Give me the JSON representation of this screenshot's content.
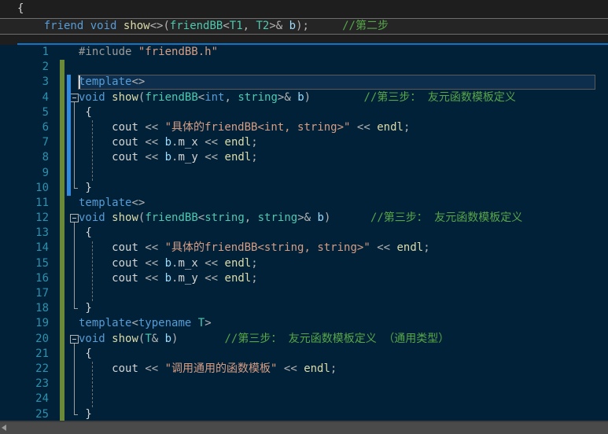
{
  "app": {
    "name": "visual-studio-code-editor",
    "theme": "dark-blue",
    "colors": {
      "editor_background": "#002137",
      "chrome_background": "#1e1e1e",
      "top_border_accent": "#0e76c8",
      "line_number": "#2b91af",
      "keyword": "#569cd6",
      "type": "#4ec9b0",
      "function": "#dcdcaa",
      "variable": "#9cdcfe",
      "string": "#d69d85",
      "comment": "#57a64a",
      "changed_gutter_green": "#6a8a3a",
      "unsaved_gutter_blue": "#2f8ae0",
      "scrollbar": "#4a4a4a"
    }
  },
  "top_pane": {
    "name": "context-fragment-pane",
    "lines": [
      {
        "n": "",
        "tokens": [
          {
            "t": "{",
            "c": "plain"
          }
        ]
      },
      {
        "n": "",
        "tokens": [
          {
            "t": "    ",
            "c": "plain"
          },
          {
            "t": "friend",
            "c": "kw"
          },
          {
            "t": " ",
            "c": "plain"
          },
          {
            "t": "void",
            "c": "kw"
          },
          {
            "t": " ",
            "c": "plain"
          },
          {
            "t": "show",
            "c": "fn"
          },
          {
            "t": "<>(",
            "c": "op"
          },
          {
            "t": "friendBB",
            "c": "typ"
          },
          {
            "t": "<",
            "c": "op"
          },
          {
            "t": "T1",
            "c": "typ"
          },
          {
            "t": ", ",
            "c": "op"
          },
          {
            "t": "T2",
            "c": "typ"
          },
          {
            "t": ">& ",
            "c": "op"
          },
          {
            "t": "b",
            "c": "var"
          },
          {
            "t": ");",
            "c": "op"
          },
          {
            "t": "     ",
            "c": "plain"
          },
          {
            "t": "//第二步",
            "c": "cmt"
          }
        ]
      }
    ]
  },
  "editor": {
    "name": "code-editor",
    "language": "cpp",
    "current_line": 3,
    "first_visible_line": 1,
    "last_visible_line": 25,
    "lines": [
      {
        "n": "1",
        "gutter": {
          "changed": false,
          "unsaved": false
        },
        "fold": null,
        "tokens": [
          {
            "t": "#include",
            "c": "pp"
          },
          {
            "t": " ",
            "c": "plain"
          },
          {
            "t": "\"friendBB.h\"",
            "c": "str"
          }
        ]
      },
      {
        "n": "2",
        "gutter": {
          "changed": true,
          "unsaved": false
        },
        "fold": null,
        "tokens": []
      },
      {
        "n": "3",
        "gutter": {
          "changed": true,
          "unsaved": true
        },
        "fold": null,
        "tokens": [
          {
            "t": "template",
            "c": "kw"
          },
          {
            "t": "<>",
            "c": "op"
          }
        ]
      },
      {
        "n": "4",
        "gutter": {
          "changed": true,
          "unsaved": true
        },
        "fold": "collapse",
        "tokens": [
          {
            "t": "void",
            "c": "kw"
          },
          {
            "t": " ",
            "c": "plain"
          },
          {
            "t": "show",
            "c": "fn"
          },
          {
            "t": "(",
            "c": "op"
          },
          {
            "t": "friendBB",
            "c": "typ"
          },
          {
            "t": "<",
            "c": "op"
          },
          {
            "t": "int",
            "c": "kw"
          },
          {
            "t": ", ",
            "c": "op"
          },
          {
            "t": "string",
            "c": "typ"
          },
          {
            "t": ">& ",
            "c": "op"
          },
          {
            "t": "b",
            "c": "var"
          },
          {
            "t": ")",
            "c": "op"
          },
          {
            "t": "        ",
            "c": "plain"
          },
          {
            "t": "//第三步： 友元函数模板定义",
            "c": "cmt"
          }
        ]
      },
      {
        "n": "5",
        "gutter": {
          "changed": true,
          "unsaved": true
        },
        "fold": null,
        "tokens": [
          {
            "t": " {",
            "c": "plain"
          }
        ]
      },
      {
        "n": "6",
        "gutter": {
          "changed": true,
          "unsaved": true
        },
        "fold": null,
        "tokens": [
          {
            "t": "     ",
            "c": "plain"
          },
          {
            "t": "cout",
            "c": "plain"
          },
          {
            "t": " ",
            "c": "plain"
          },
          {
            "t": "<<",
            "c": "op"
          },
          {
            "t": " ",
            "c": "plain"
          },
          {
            "t": "\"具体的friendBB<int, string>\"",
            "c": "str"
          },
          {
            "t": " ",
            "c": "plain"
          },
          {
            "t": "<<",
            "c": "op"
          },
          {
            "t": " ",
            "c": "plain"
          },
          {
            "t": "endl",
            "c": "mem"
          },
          {
            "t": ";",
            "c": "op"
          }
        ]
      },
      {
        "n": "7",
        "gutter": {
          "changed": true,
          "unsaved": true
        },
        "fold": null,
        "tokens": [
          {
            "t": "     ",
            "c": "plain"
          },
          {
            "t": "cout",
            "c": "plain"
          },
          {
            "t": " ",
            "c": "plain"
          },
          {
            "t": "<<",
            "c": "op"
          },
          {
            "t": " ",
            "c": "plain"
          },
          {
            "t": "b",
            "c": "var"
          },
          {
            "t": ".",
            "c": "op"
          },
          {
            "t": "m_x",
            "c": "plain"
          },
          {
            "t": " ",
            "c": "plain"
          },
          {
            "t": "<<",
            "c": "op"
          },
          {
            "t": " ",
            "c": "plain"
          },
          {
            "t": "endl",
            "c": "mem"
          },
          {
            "t": ";",
            "c": "op"
          }
        ]
      },
      {
        "n": "8",
        "gutter": {
          "changed": true,
          "unsaved": true
        },
        "fold": null,
        "tokens": [
          {
            "t": "     ",
            "c": "plain"
          },
          {
            "t": "cout",
            "c": "plain"
          },
          {
            "t": " ",
            "c": "plain"
          },
          {
            "t": "<<",
            "c": "op"
          },
          {
            "t": " ",
            "c": "plain"
          },
          {
            "t": "b",
            "c": "var"
          },
          {
            "t": ".",
            "c": "op"
          },
          {
            "t": "m_y",
            "c": "plain"
          },
          {
            "t": " ",
            "c": "plain"
          },
          {
            "t": "<<",
            "c": "op"
          },
          {
            "t": " ",
            "c": "plain"
          },
          {
            "t": "endl",
            "c": "mem"
          },
          {
            "t": ";",
            "c": "op"
          }
        ]
      },
      {
        "n": "9",
        "gutter": {
          "changed": true,
          "unsaved": true
        },
        "fold": null,
        "tokens": []
      },
      {
        "n": "10",
        "gutter": {
          "changed": true,
          "unsaved": true
        },
        "fold": "end",
        "tokens": [
          {
            "t": " }",
            "c": "plain"
          }
        ]
      },
      {
        "n": "11",
        "gutter": {
          "changed": true,
          "unsaved": false
        },
        "fold": null,
        "tokens": [
          {
            "t": "template",
            "c": "kw"
          },
          {
            "t": "<>",
            "c": "op"
          }
        ]
      },
      {
        "n": "12",
        "gutter": {
          "changed": true,
          "unsaved": false
        },
        "fold": "collapse",
        "tokens": [
          {
            "t": "void",
            "c": "kw"
          },
          {
            "t": " ",
            "c": "plain"
          },
          {
            "t": "show",
            "c": "fn"
          },
          {
            "t": "(",
            "c": "op"
          },
          {
            "t": "friendBB",
            "c": "typ"
          },
          {
            "t": "<",
            "c": "op"
          },
          {
            "t": "string",
            "c": "typ"
          },
          {
            "t": ", ",
            "c": "op"
          },
          {
            "t": "string",
            "c": "typ"
          },
          {
            "t": ">& ",
            "c": "op"
          },
          {
            "t": "b",
            "c": "var"
          },
          {
            "t": ")",
            "c": "op"
          },
          {
            "t": "      ",
            "c": "plain"
          },
          {
            "t": "//第三步： 友元函数模板定义",
            "c": "cmt"
          }
        ]
      },
      {
        "n": "13",
        "gutter": {
          "changed": true,
          "unsaved": false
        },
        "fold": null,
        "tokens": [
          {
            "t": " {",
            "c": "plain"
          }
        ]
      },
      {
        "n": "14",
        "gutter": {
          "changed": true,
          "unsaved": false
        },
        "fold": null,
        "tokens": [
          {
            "t": "     ",
            "c": "plain"
          },
          {
            "t": "cout",
            "c": "plain"
          },
          {
            "t": " ",
            "c": "plain"
          },
          {
            "t": "<<",
            "c": "op"
          },
          {
            "t": " ",
            "c": "plain"
          },
          {
            "t": "\"具体的friendBB<string, string>\"",
            "c": "str"
          },
          {
            "t": " ",
            "c": "plain"
          },
          {
            "t": "<<",
            "c": "op"
          },
          {
            "t": " ",
            "c": "plain"
          },
          {
            "t": "endl",
            "c": "mem"
          },
          {
            "t": ";",
            "c": "op"
          }
        ]
      },
      {
        "n": "15",
        "gutter": {
          "changed": true,
          "unsaved": false
        },
        "fold": null,
        "tokens": [
          {
            "t": "     ",
            "c": "plain"
          },
          {
            "t": "cout",
            "c": "plain"
          },
          {
            "t": " ",
            "c": "plain"
          },
          {
            "t": "<<",
            "c": "op"
          },
          {
            "t": " ",
            "c": "plain"
          },
          {
            "t": "b",
            "c": "var"
          },
          {
            "t": ".",
            "c": "op"
          },
          {
            "t": "m_x",
            "c": "plain"
          },
          {
            "t": " ",
            "c": "plain"
          },
          {
            "t": "<<",
            "c": "op"
          },
          {
            "t": " ",
            "c": "plain"
          },
          {
            "t": "endl",
            "c": "mem"
          },
          {
            "t": ";",
            "c": "op"
          }
        ]
      },
      {
        "n": "16",
        "gutter": {
          "changed": true,
          "unsaved": false
        },
        "fold": null,
        "tokens": [
          {
            "t": "     ",
            "c": "plain"
          },
          {
            "t": "cout",
            "c": "plain"
          },
          {
            "t": " ",
            "c": "plain"
          },
          {
            "t": "<<",
            "c": "op"
          },
          {
            "t": " ",
            "c": "plain"
          },
          {
            "t": "b",
            "c": "var"
          },
          {
            "t": ".",
            "c": "op"
          },
          {
            "t": "m_y",
            "c": "plain"
          },
          {
            "t": " ",
            "c": "plain"
          },
          {
            "t": "<<",
            "c": "op"
          },
          {
            "t": " ",
            "c": "plain"
          },
          {
            "t": "endl",
            "c": "mem"
          },
          {
            "t": ";",
            "c": "op"
          }
        ]
      },
      {
        "n": "17",
        "gutter": {
          "changed": true,
          "unsaved": false
        },
        "fold": null,
        "tokens": []
      },
      {
        "n": "18",
        "gutter": {
          "changed": true,
          "unsaved": false
        },
        "fold": "end",
        "tokens": [
          {
            "t": " }",
            "c": "plain"
          }
        ]
      },
      {
        "n": "19",
        "gutter": {
          "changed": true,
          "unsaved": false
        },
        "fold": null,
        "tokens": [
          {
            "t": "template",
            "c": "kw"
          },
          {
            "t": "<",
            "c": "op"
          },
          {
            "t": "typename",
            "c": "kw"
          },
          {
            "t": " ",
            "c": "plain"
          },
          {
            "t": "T",
            "c": "typ"
          },
          {
            "t": ">",
            "c": "op"
          }
        ]
      },
      {
        "n": "20",
        "gutter": {
          "changed": true,
          "unsaved": false
        },
        "fold": "collapse",
        "tokens": [
          {
            "t": "void",
            "c": "kw"
          },
          {
            "t": " ",
            "c": "plain"
          },
          {
            "t": "show",
            "c": "fn"
          },
          {
            "t": "(",
            "c": "op"
          },
          {
            "t": "T",
            "c": "typ"
          },
          {
            "t": "& ",
            "c": "op"
          },
          {
            "t": "b",
            "c": "var"
          },
          {
            "t": ")",
            "c": "op"
          },
          {
            "t": "       ",
            "c": "plain"
          },
          {
            "t": "//第三步： 友元函数模板定义 （通用类型）",
            "c": "cmt"
          }
        ]
      },
      {
        "n": "21",
        "gutter": {
          "changed": true,
          "unsaved": false
        },
        "fold": null,
        "tokens": [
          {
            "t": " {",
            "c": "plain"
          }
        ]
      },
      {
        "n": "22",
        "gutter": {
          "changed": true,
          "unsaved": false
        },
        "fold": null,
        "tokens": [
          {
            "t": "     ",
            "c": "plain"
          },
          {
            "t": "cout",
            "c": "plain"
          },
          {
            "t": " ",
            "c": "plain"
          },
          {
            "t": "<<",
            "c": "op"
          },
          {
            "t": " ",
            "c": "plain"
          },
          {
            "t": "\"调用通用的函数模板\"",
            "c": "str"
          },
          {
            "t": " ",
            "c": "plain"
          },
          {
            "t": "<<",
            "c": "op"
          },
          {
            "t": " ",
            "c": "plain"
          },
          {
            "t": "endl",
            "c": "mem"
          },
          {
            "t": ";",
            "c": "op"
          }
        ]
      },
      {
        "n": "23",
        "gutter": {
          "changed": true,
          "unsaved": false
        },
        "fold": null,
        "tokens": []
      },
      {
        "n": "24",
        "gutter": {
          "changed": true,
          "unsaved": false
        },
        "fold": null,
        "tokens": []
      },
      {
        "n": "25",
        "gutter": {
          "changed": true,
          "unsaved": false
        },
        "fold": "end",
        "tokens": [
          {
            "t": " }",
            "c": "plain"
          }
        ]
      }
    ]
  },
  "scrollbar": {
    "name": "horizontal-scrollbar",
    "orientation": "horizontal",
    "left_arrow_icon": "triangle-left-icon"
  }
}
